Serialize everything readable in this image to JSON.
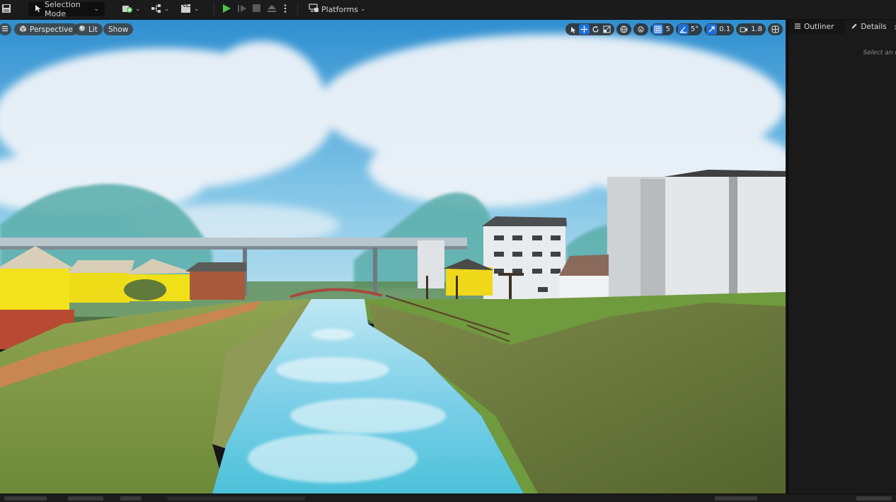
{
  "toolbar": {
    "selection_mode_label": "Selection Mode",
    "platforms_label": "Platforms",
    "icons": [
      "save-icon",
      "selection-mode-icon",
      "add-actor-icon",
      "blueprint-icon",
      "cinematics-icon",
      "play-icon",
      "step-icon",
      "stop-icon",
      "eject-icon",
      "more-options-icon",
      "platforms-icon"
    ]
  },
  "viewport": {
    "perspective_label": "Perspective",
    "lit_label": "Lit",
    "show_label": "Show",
    "grid_snap_value": "5",
    "rotation_snap_value": "5°",
    "scale_snap_value": "0.1",
    "camera_speed_value": "1.8"
  },
  "panel": {
    "outliner_label": "Outliner",
    "details_label": "Details",
    "close_symbol": "×",
    "empty_hint": "Select an object"
  },
  "colors": {
    "accent": "#1f6fd6",
    "play_green": "#4ec34e",
    "panel_bg": "#1a1a1a",
    "toolbar_bg": "#1b1b1b"
  }
}
